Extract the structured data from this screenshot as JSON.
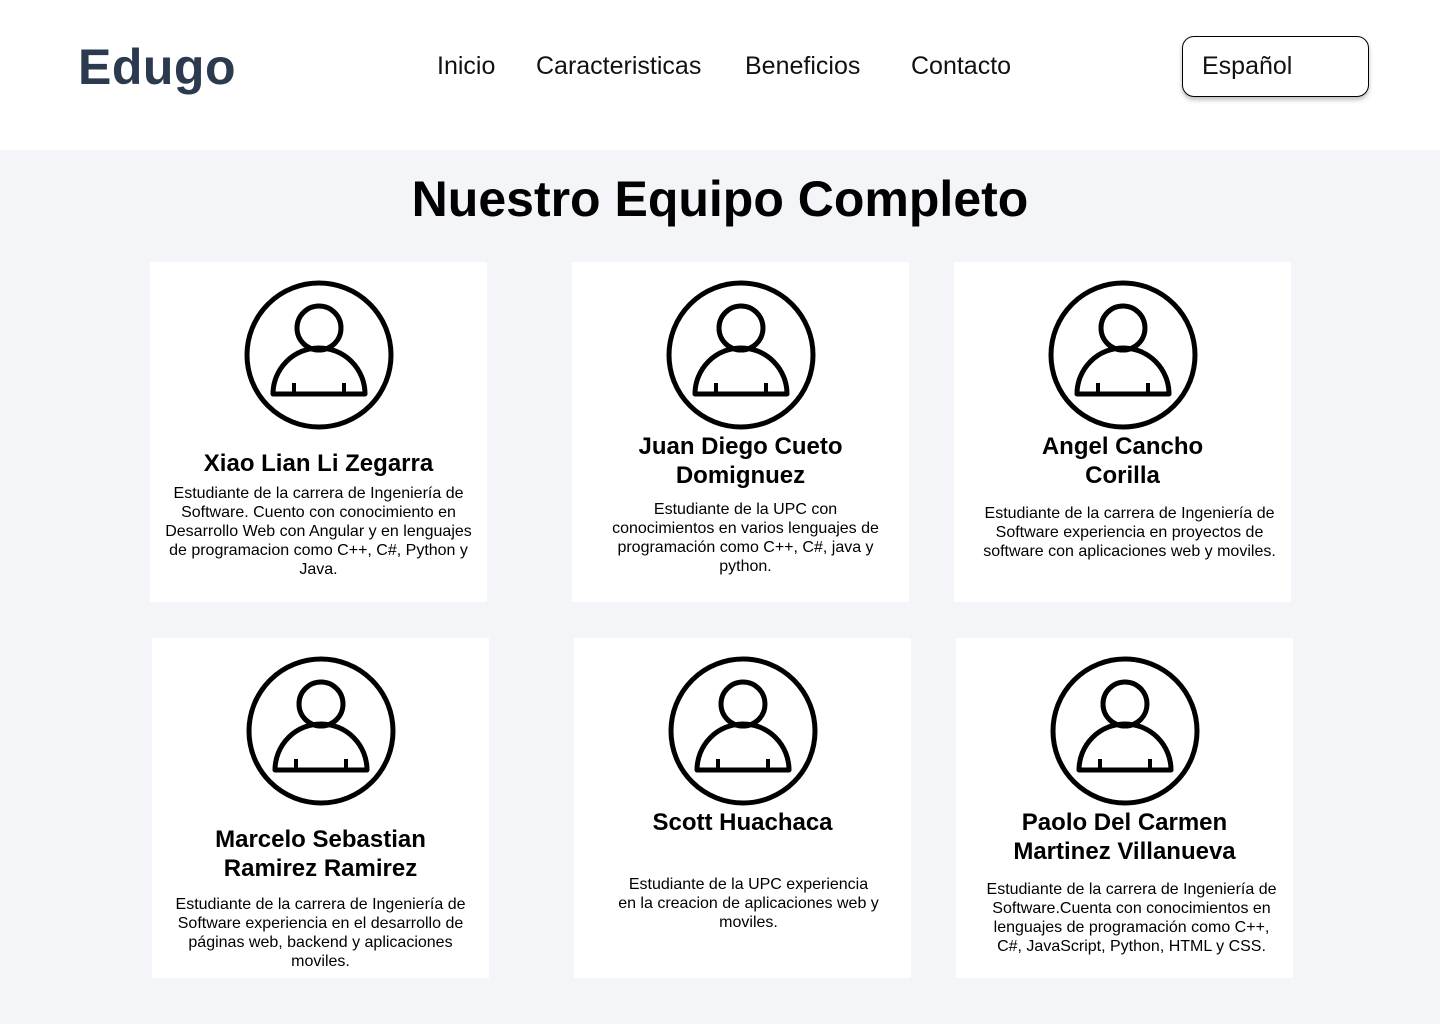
{
  "header": {
    "logo": "Edugo",
    "nav": [
      {
        "label": "Inicio"
      },
      {
        "label": "Caracteristicas"
      },
      {
        "label": "Beneficios"
      },
      {
        "label": "Contacto"
      }
    ],
    "language": "Español"
  },
  "main": {
    "title": "Nuestro Equipo Completo",
    "members": [
      {
        "name": "Xiao Lian Li Zegarra",
        "description": "Estudiante de la carrera de Ingeniería de Software. Cuento con conocimiento en Desarrollo Web con Angular y en lenguajes de programacion como C++, C#, Python y Java.",
        "icon": "user-icon"
      },
      {
        "name": "Juan Diego Cueto Domignuez",
        "description": "Estudiante de la UPC con conocimientos en varios lenguajes de programación como C++, C#, java y python.",
        "icon": "user-icon"
      },
      {
        "name": "Angel Cancho Corilla",
        "description": "Estudiante de la carrera de Ingeniería de Software experiencia en proyectos de software con aplicaciones web y moviles.",
        "icon": "user-icon"
      },
      {
        "name": "Marcelo Sebastian Ramirez Ramirez",
        "description": "Estudiante de la carrera de Ingeniería de Software experiencia en el desarrollo de páginas web, backend y aplicaciones moviles.",
        "icon": "user-icon"
      },
      {
        "name": "Scott Huachaca",
        "description": "Estudiante de la UPC experiencia en la creacion de aplicaciones web y moviles.",
        "icon": "user-icon"
      },
      {
        "name": "Paolo Del Carmen Martinez Villanueva",
        "description": "Estudiante de la carrera de Ingeniería de Software.Cuenta con conocimientos en lenguajes de programación como C++, C#, JavaScript, Python, HTML y CSS.",
        "icon": "user-icon"
      }
    ]
  },
  "colors": {
    "logo": "#2b3a4f",
    "section_background": "#f4f5f9",
    "card_background": "#ffffff",
    "text": "#000000"
  }
}
